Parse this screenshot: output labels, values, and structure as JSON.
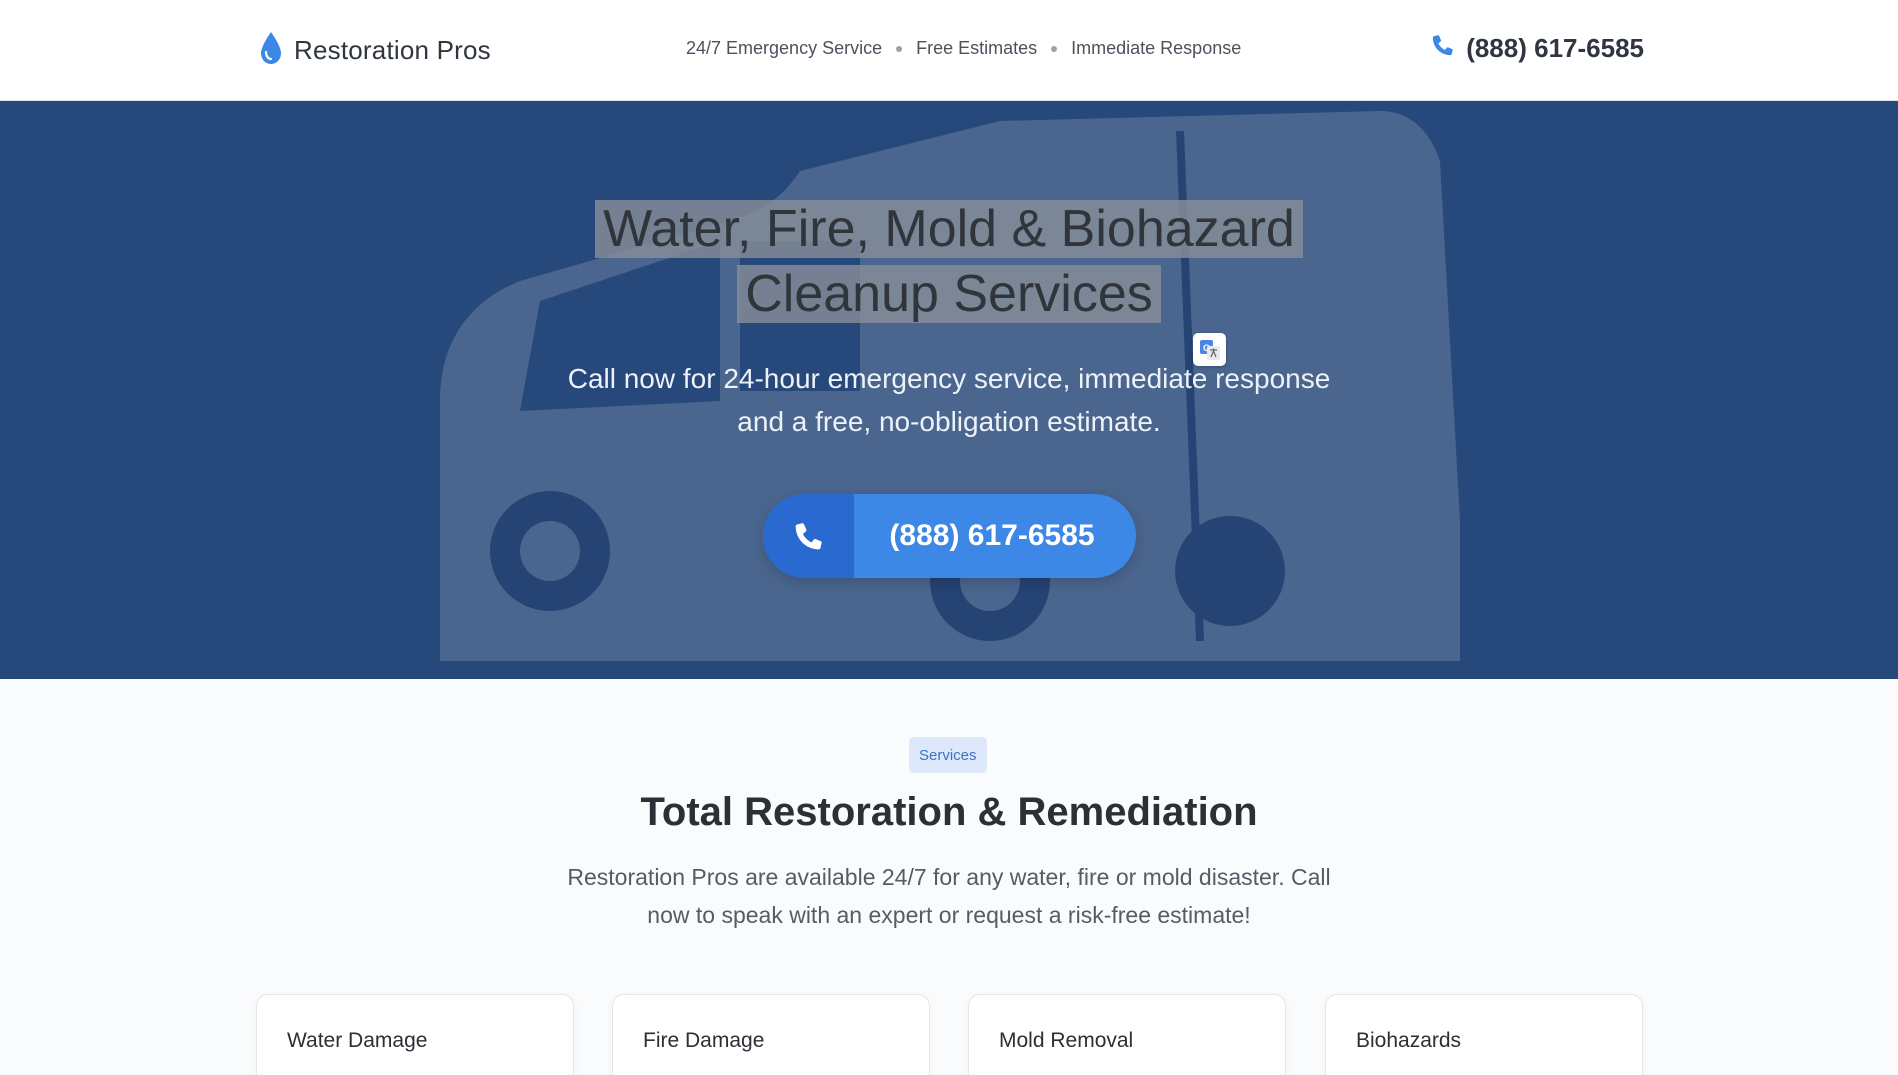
{
  "header": {
    "brand_name": "Restoration Pros",
    "brand_icon": "water-drop-icon",
    "taglines": [
      "24/7 Emergency Service",
      "Free Estimates",
      "Immediate Response"
    ],
    "phone": "(888) 617-6585",
    "phone_icon": "phone-icon"
  },
  "hero": {
    "title_line1": "Water, Fire, Mold & Biohazard",
    "title_line2": "Cleanup Services",
    "subtitle": "Call now for 24-hour emergency service, immediate response and a free, no-obligation estimate.",
    "cta_phone": "(888) 617-6585",
    "translate_icon": "google-translate-icon"
  },
  "services": {
    "badge": "Services",
    "title": "Total Restoration & Remediation",
    "description": "Restoration Pros are available 24/7 for any water, fire or mold disaster. Call now to speak with an expert or request a risk-free estimate!",
    "cards": [
      {
        "title": "Water Damage"
      },
      {
        "title": "Fire Damage"
      },
      {
        "title": "Mold Removal"
      },
      {
        "title": "Biohazards"
      }
    ]
  },
  "colors": {
    "accent": "#3d87e6",
    "accent_dark": "#2a6ad0",
    "hero_bg": "#27487a",
    "badge_bg": "#dde9fb"
  }
}
